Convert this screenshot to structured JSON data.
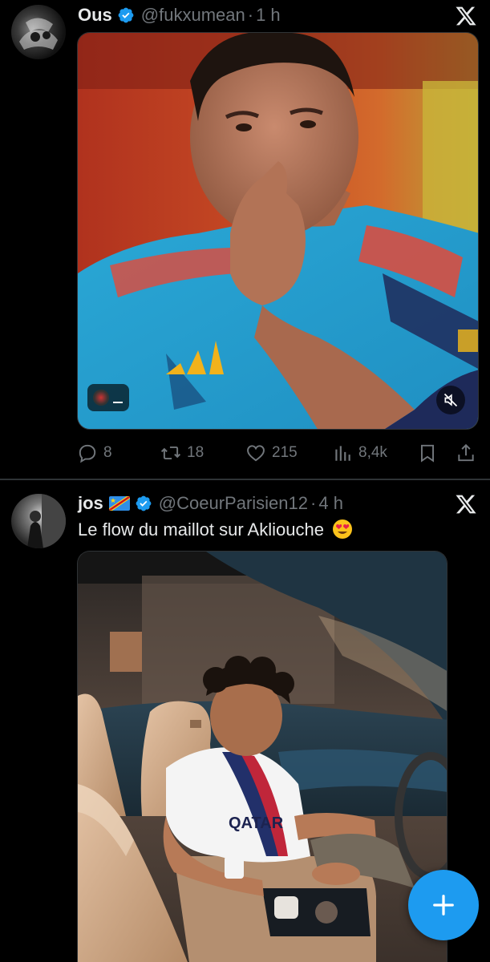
{
  "tweets": [
    {
      "author_name": "Ous",
      "handle": "@fukxumean",
      "separator": "·",
      "time": "1 h",
      "text": "",
      "media": "video",
      "metrics": {
        "replies": "8",
        "reposts": "18",
        "likes": "215",
        "views": "8,4k"
      }
    },
    {
      "author_name": "jos",
      "handle": "@CoeurParisien12",
      "separator": "·",
      "time": "4 h",
      "text": "Le flow du maillot sur Akliouche",
      "media": "photo",
      "player_shirt_print": "QATAR AIRWAYS"
    }
  ],
  "icons": {
    "verified": "verified-badge-icon",
    "x_logo": "x-logo-icon",
    "reply": "reply-icon",
    "repost": "repost-icon",
    "like": "heart-icon",
    "views": "views-icon",
    "bookmark": "bookmark-icon",
    "share": "share-icon",
    "compose": "plus-icon",
    "mute": "muted-speaker-icon",
    "flag": "drc-flag-icon",
    "emoji": "heart-eyes-emoji-icon"
  },
  "colors": {
    "background": "#000000",
    "text_primary": "#e7e9ea",
    "text_secondary": "#71767b",
    "verified_blue": "#1d9bf0",
    "fab_blue": "#1d9bf0",
    "divider": "#2f3336"
  }
}
